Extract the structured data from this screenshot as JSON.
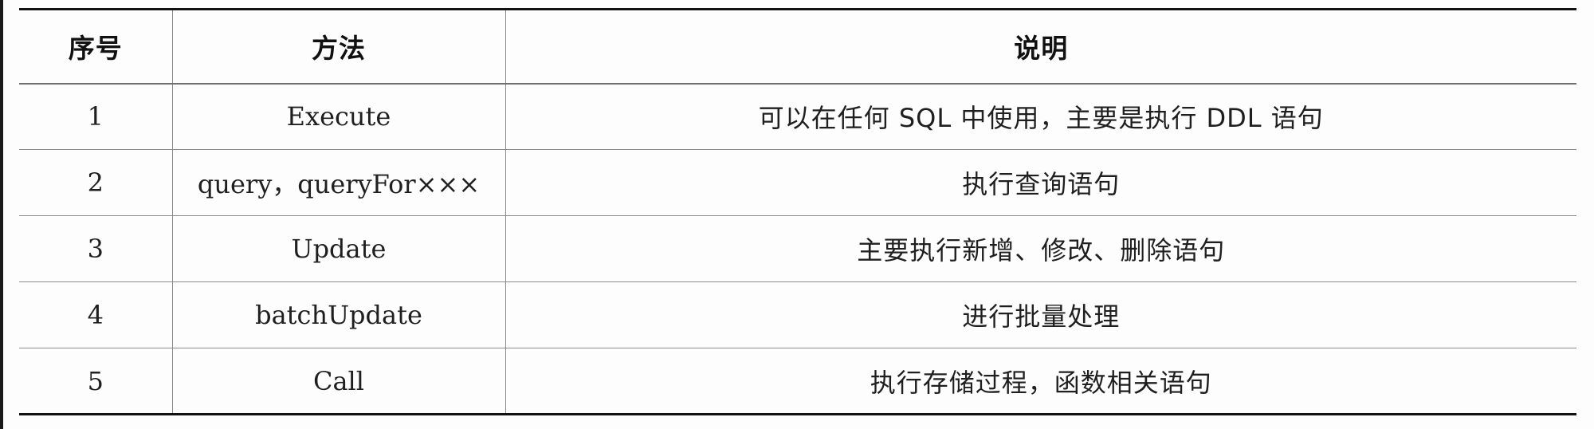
{
  "table": {
    "headers": [
      "序号",
      "方法",
      "说明"
    ],
    "rows": [
      {
        "index": "1",
        "method": "Execute",
        "description": "可以在任何 SQL 中使用，主要是执行 DDL 语句"
      },
      {
        "index": "2",
        "method": "query，queryFor×××",
        "description": "执行查询语句"
      },
      {
        "index": "3",
        "method": "Update",
        "description": "主要执行新增、修改、删除语句"
      },
      {
        "index": "4",
        "method": "batchUpdate",
        "description": "进行批量处理"
      },
      {
        "index": "5",
        "method": "Call",
        "description": "执行存储过程，函数相关语句"
      }
    ]
  }
}
